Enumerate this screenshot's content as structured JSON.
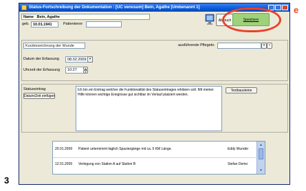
{
  "window": {
    "title": "Status-Fortschreibung der Dokumentation : [UC venosum]  Bein, Agathe [Umbenannt 1]"
  },
  "patient": {
    "name_label": "Name",
    "name_value": "Bein, Agathe",
    "dob_label": "geb.",
    "dob_value": "10.01.1941",
    "patient_nr_label": "Patientennr"
  },
  "toolbar": {
    "abbruch_label": "Abbruch",
    "speichern_label": "Speichern"
  },
  "form": {
    "kurzbezeichnung_placeholder": "Kurzbezeichnung der Wunde",
    "pflegekraft_label": "ausführende Pflegekr.",
    "datum_label": "Datum der Erfassung",
    "datum_value": "08.02.2009",
    "uhrzeit_label": "Uhrzeit der Erfassung",
    "uhrzeit_value": "10:27"
  },
  "status": {
    "label": "Statuseintrag",
    "datetime_button": "Datum/Zeit einfügen",
    "text": "Ich bin ein Eintrag welcher die Funktionalität des Statuseintrages erklären soll. Mit meiner Hilfe können wichtige Ereignisse gut sichtbar im Verlauf platziert werden.",
    "textbausteine_button": "Textbausteine"
  },
  "history": {
    "rows": [
      {
        "date": "20.01.2009",
        "text": "Patient unternimmt täglich Spaziergänge mit ca. 5 KM Länge.",
        "author": "Eddy Wunder"
      },
      {
        "date": "12.01.2009",
        "text": "Verlegung von Station A auf Station B",
        "author": "Stefan Demo"
      }
    ]
  },
  "annotations": {
    "marker_e": "e",
    "marker_3": "3"
  }
}
